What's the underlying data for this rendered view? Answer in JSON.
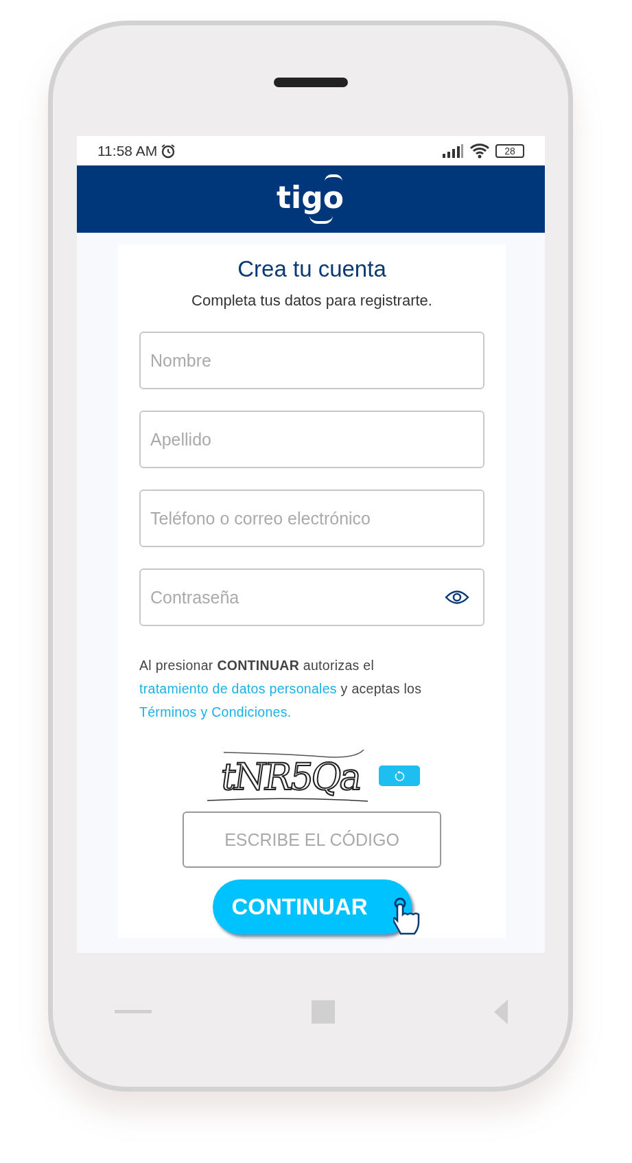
{
  "status_bar": {
    "time": "11:58 AM",
    "battery": "28"
  },
  "header": {
    "logo": "tigo"
  },
  "form": {
    "title": "Crea tu cuenta",
    "subtitle": "Completa tus datos para registrarte.",
    "fields": [
      {
        "kind": "text",
        "placeholder": "Nombre"
      },
      {
        "kind": "text",
        "placeholder": "Apellido"
      },
      {
        "kind": "text",
        "placeholder": "Teléfono o correo electrónico"
      },
      {
        "kind": "password",
        "placeholder": "Contraseña"
      }
    ],
    "consent": [
      {
        "kind": "text",
        "text": "Al presionar **CONTINUAR** autorizas el"
      },
      {
        "kind": "link",
        "text": "tratamiento de datos personales"
      },
      {
        "kind": "text",
        "text": "y aceptas los"
      },
      {
        "kind": "link",
        "text": "Términos y Condiciones."
      }
    ],
    "captcha": {
      "code": "tNR5Qa"
    },
    "code_field": {
      "placeholder": "ESCRIBE EL CÓDIGO"
    },
    "submit": "CONTINUAR"
  }
}
